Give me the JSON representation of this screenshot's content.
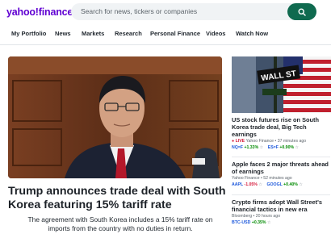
{
  "header": {
    "logo_brand": "yahoo!",
    "logo_section": "finance",
    "search_placeholder": "Search for news, tickers or companies"
  },
  "nav": {
    "items": [
      "My Portfolio",
      "News",
      "Markets",
      "Research",
      "Personal Finance",
      "Videos",
      "Watch Now"
    ]
  },
  "hero": {
    "headline": "Trump announces trade deal with South Korea featuring 15% tariff rate",
    "summary": "The agreement with South Korea includes a 15% tariff rate on imports from the country with no duties in return.",
    "image": "man in dark suit, glasses and red tie, seated in wood-panelled room"
  },
  "rail": {
    "image": "Wall St street sign with American flags",
    "image_sign": "WALL ST",
    "stories": [
      {
        "title": "US stock futures rise on South Korea trade deal, Big Tech earnings",
        "live": "LIVE",
        "source": "Yahoo Finance",
        "time": "37 minutes ago",
        "tickers": [
          {
            "symbol": "NQ=F",
            "change": "+1.33%",
            "direction": "up"
          },
          {
            "symbol": "ES=F",
            "change": "+0.90%",
            "direction": "up"
          }
        ]
      },
      {
        "title": "Apple faces 2 major threats ahead of earnings",
        "source": "Yahoo Finance",
        "time": "52 minutes ago",
        "tickers": [
          {
            "symbol": "AAPL",
            "change": "-1.05%",
            "direction": "down"
          },
          {
            "symbol": "GOOGL",
            "change": "+0.40%",
            "direction": "up"
          }
        ]
      },
      {
        "title": "Crypto firms adopt Wall Street's financial tactics in new era",
        "source": "Bloomberg",
        "time": "20 hours ago",
        "tickers": [
          {
            "symbol": "BTC-USD",
            "change": "+0.35%",
            "direction": "up"
          }
        ]
      }
    ]
  },
  "colors": {
    "brand_purple": "#6001d2",
    "search_button": "#0f6a4f",
    "positive": "#008a00",
    "negative": "#d5193a",
    "ticker_link": "#1a56db"
  }
}
